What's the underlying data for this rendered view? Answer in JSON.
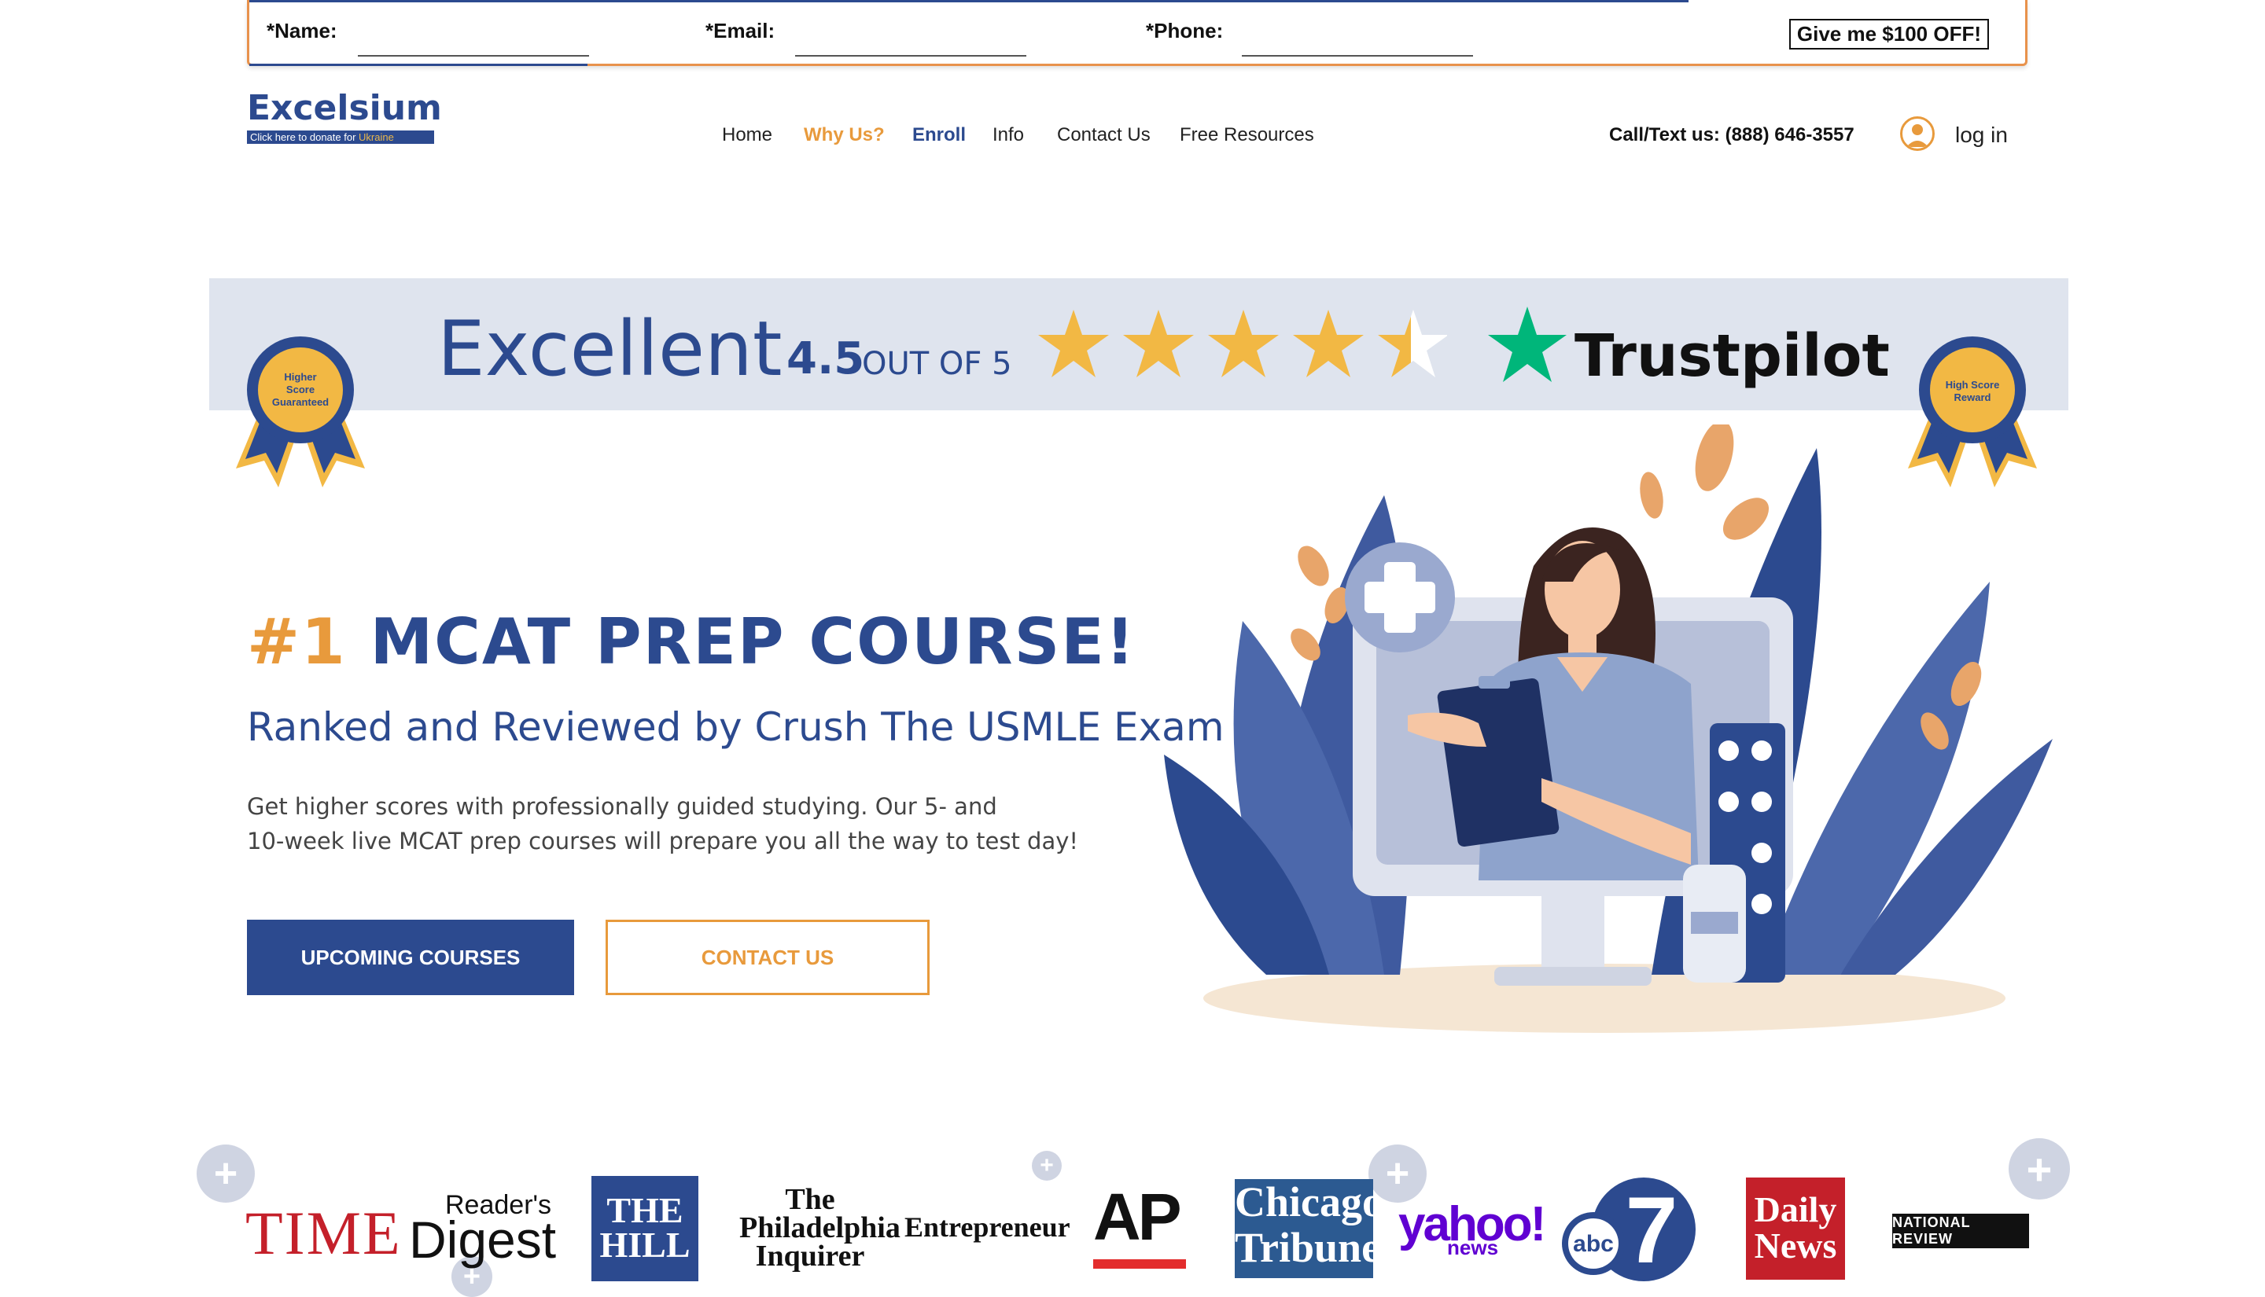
{
  "lead_form": {
    "name_label": "*Name:",
    "email_label": "*Email:",
    "phone_label": "*Phone:",
    "name_value": "",
    "email_value": "",
    "phone_value": "",
    "submit_label": "Give me $100 OFF!"
  },
  "header": {
    "logo_text": "Excelsium",
    "donate_text": "Click here to donate for ",
    "donate_highlight": "Ukraine",
    "nav": [
      "Home",
      "Why Us?",
      "Enroll",
      "Info",
      "Contact Us",
      "Free Resources"
    ],
    "phone": "Call/Text us: (888) 646-3557",
    "login": "log in"
  },
  "rating": {
    "label": "Excellent",
    "score": "4.5",
    "out_of": "OUT OF 5",
    "stars_value": 4.5,
    "stars_max": 5,
    "brand": "Trustpilot",
    "badge_left": [
      "Higher",
      "Score",
      "Guaranteed"
    ],
    "badge_right": [
      "High Score",
      "Reward"
    ]
  },
  "hero": {
    "title_num": "#1",
    "title_rest": "MCAT PREP COURSE!",
    "subtitle": "Ranked and Reviewed by Crush The USMLE Exam",
    "body_line1": "Get higher scores with professionally guided studying. Our 5- and",
    "body_line2": "10-week live MCAT prep courses will prepare you all the way to test day!",
    "primary_button": "UPCOMING COURSES",
    "secondary_button": "CONTACT US"
  },
  "press": {
    "time": "TIME",
    "readers_top": "Reader's",
    "readers_bottom": "Digest",
    "hill_1": "THE",
    "hill_2": "HILL",
    "philly_1": "The",
    "philly_2": "Philadelphia",
    "philly_3": "Inquirer",
    "entrepreneur": "Entrepreneur",
    "ap": "AP",
    "chicago_1": "Chicago",
    "chicago_2": "Tribune",
    "yahoo": "yahoo!",
    "yahoo_news": "news",
    "abc": "abc",
    "abc_num": "7",
    "daily_1": "Daily",
    "daily_2": "News",
    "national_review": "NATIONAL REVIEW"
  },
  "colors": {
    "brand_blue": "#2c4a8f",
    "accent_orange": "#e89a3c",
    "star_yellow": "#f2b844",
    "trustpilot_green": "#00b67a"
  }
}
